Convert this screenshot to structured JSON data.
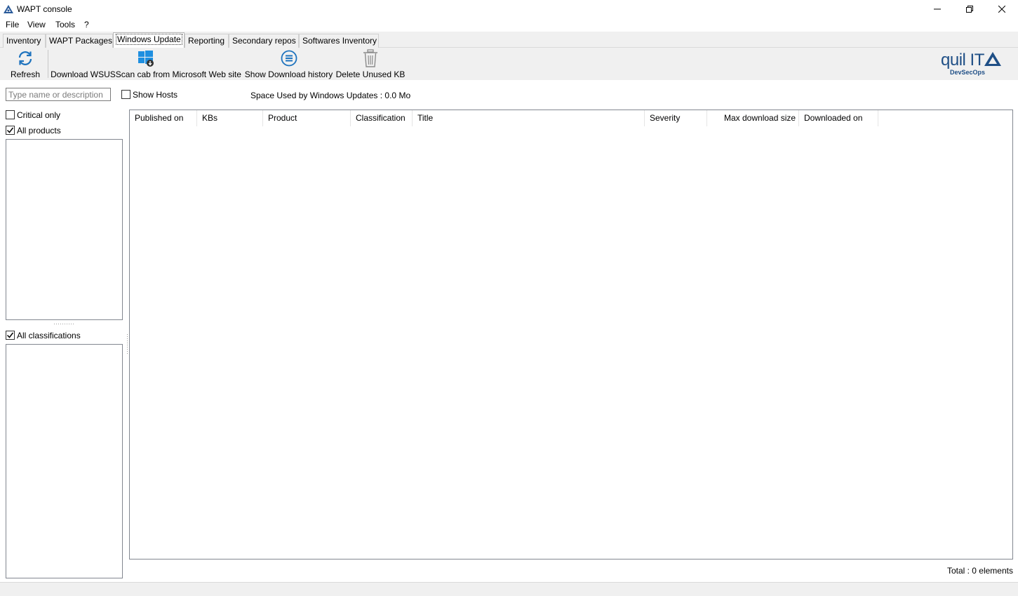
{
  "window": {
    "title": "WAPT console"
  },
  "menu": {
    "items": [
      "File",
      "View",
      "Tools",
      "?"
    ]
  },
  "tabs": [
    {
      "label": "Inventory",
      "active": false
    },
    {
      "label": "WAPT Packages",
      "active": false
    },
    {
      "label": "Windows Update",
      "active": true
    },
    {
      "label": "Reporting",
      "active": false
    },
    {
      "label": "Secondary repos",
      "active": false
    },
    {
      "label": "Softwares Inventory",
      "active": false
    }
  ],
  "toolbar": {
    "refresh": "Refresh",
    "download_wsusscan": "Download WSUSScan cab from Microsoft Web site",
    "show_download_history": "Show Download history",
    "delete_unused_kb": "Delete Unused KB"
  },
  "logo": {
    "name": "quil IT",
    "tagline": "DevSecOps"
  },
  "filters": {
    "search_placeholder": "Type name or description",
    "search_value": "",
    "show_hosts": {
      "label": "Show Hosts",
      "checked": false
    },
    "space_used": "Space Used by Windows Updates : 0.0 Mo",
    "critical_only": {
      "label": "Critical only",
      "checked": false
    },
    "all_products": {
      "label": "All products",
      "checked": true
    },
    "all_classifications": {
      "label": "All classifications",
      "checked": true
    }
  },
  "grid": {
    "columns": [
      "Published on",
      "KBs",
      "Product",
      "Classification",
      "Title",
      "Severity",
      "Max download size",
      "Downloaded on"
    ],
    "rows": []
  },
  "footer": {
    "total": "Total : 0 elements"
  },
  "colors": {
    "accent": "#1e73be",
    "logo": "#1f4f86",
    "chrome": "#f0f0f0"
  }
}
